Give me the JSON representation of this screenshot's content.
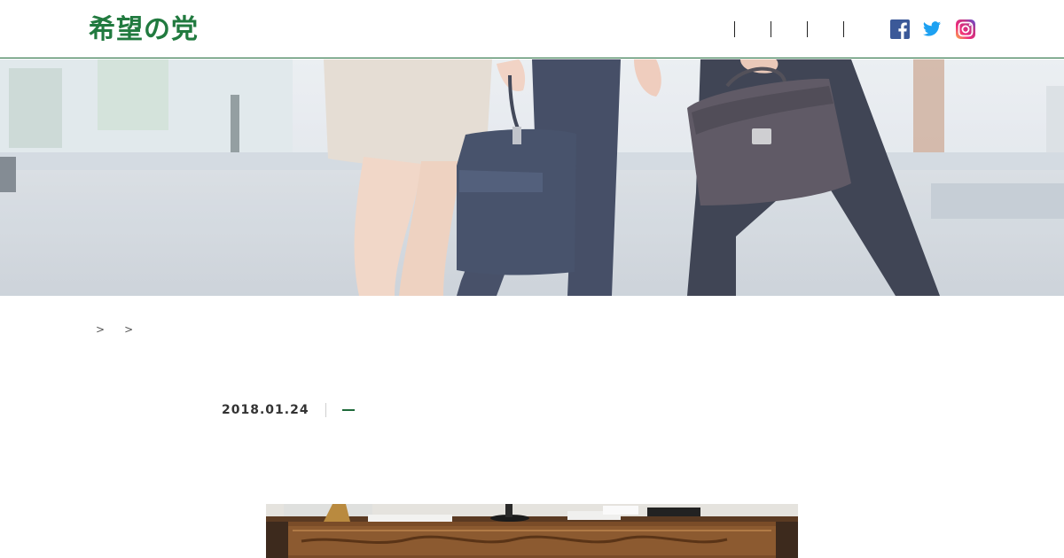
{
  "header": {
    "logo_text": "希望の党",
    "nav_items": [
      "",
      "",
      "",
      ""
    ],
    "social": [
      {
        "icon": "facebook-icon",
        "color": "#3b5998"
      },
      {
        "icon": "twitter-icon",
        "color": "#1da1f2"
      },
      {
        "icon": "instagram-icon",
        "color": "#c13584"
      }
    ]
  },
  "breadcrumb": {
    "items": [
      "",
      ""
    ],
    "current": ""
  },
  "article": {
    "date": "2018.01.24",
    "category": "",
    "title": ""
  },
  "colors": {
    "brand_green": "#2a8a4c",
    "header_border": "#1f6a3a"
  }
}
